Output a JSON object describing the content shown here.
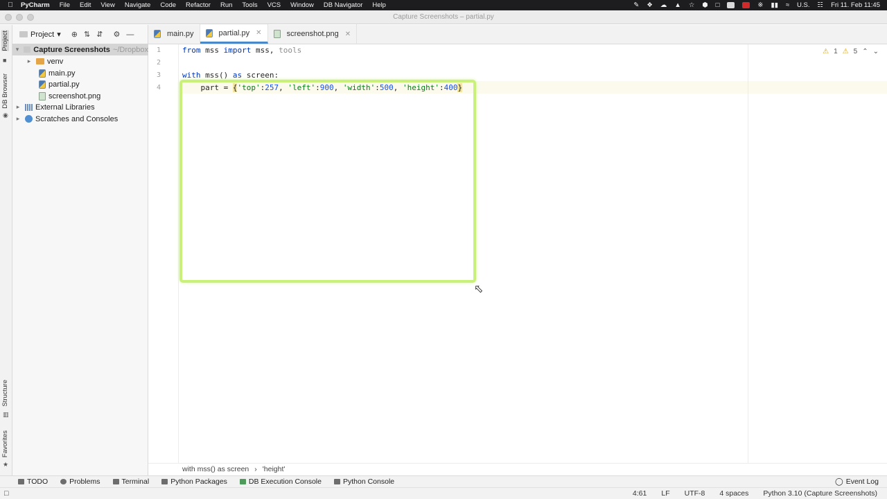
{
  "menubar": {
    "app_name": "PyCharm",
    "items": [
      "File",
      "Edit",
      "View",
      "Navigate",
      "Code",
      "Refactor",
      "Run",
      "Tools",
      "VCS",
      "Window",
      "DB Navigator",
      "Help"
    ],
    "input_source": "U.S.",
    "clock": "Fri 11. Feb  11:45"
  },
  "window": {
    "title": "Capture Screenshots – partial.py"
  },
  "left_stripe": {
    "project": "Project",
    "db_browser": "DB Browser",
    "structure": "Structure",
    "favorites": "Favorites"
  },
  "project_panel": {
    "selector_label": "Project",
    "tree": [
      {
        "label": "Capture Screenshots",
        "hint": "~/Dropbox",
        "kind": "root"
      },
      {
        "label": "venv",
        "kind": "folder"
      },
      {
        "label": "main.py",
        "kind": "py"
      },
      {
        "label": "partial.py",
        "kind": "py"
      },
      {
        "label": "screenshot.png",
        "kind": "png"
      },
      {
        "label": "External Libraries",
        "kind": "lib"
      },
      {
        "label": "Scratches and Consoles",
        "kind": "scratch"
      }
    ]
  },
  "tabs": [
    {
      "label": "main.py",
      "active": false
    },
    {
      "label": "partial.py",
      "active": true
    },
    {
      "label": "screenshot.png",
      "active": false
    }
  ],
  "editor": {
    "line_numbers": [
      "1",
      "2",
      "3",
      "4"
    ],
    "code": {
      "l1_from": "from",
      "l1_mss": " mss ",
      "l1_import": "import",
      "l1_rest": " mss, ",
      "l1_tools": "tools",
      "l3_with": "with",
      "l3_rest": " mss() ",
      "l3_as": "as",
      "l3_end": " screen:",
      "l4_indent": "    part = ",
      "l4_open": "{",
      "l4_k1": "'top'",
      "l4_c1": ":",
      "l4_v1": "257",
      "l4_s1": ", ",
      "l4_k2": "'left'",
      "l4_c2": ":",
      "l4_v2": "900",
      "l4_s2": ", ",
      "l4_k3": "'width'",
      "l4_c3": ":",
      "l4_v3": "500",
      "l4_s3": ", ",
      "l4_k4": "'height'",
      "l4_c4": ":",
      "l4_v4": "400",
      "l4_close": "}"
    },
    "inspections": {
      "errors": "1",
      "warnings": "5"
    }
  },
  "breadcrumb": [
    "with mss() as screen",
    "'height'"
  ],
  "breadcrumb_sep": "›",
  "tool_windows": [
    "TODO",
    "Problems",
    "Terminal",
    "Python Packages",
    "DB Execution Console",
    "Python Console"
  ],
  "event_log": "Event Log",
  "status": {
    "position": "4:61",
    "line_sep": "LF",
    "encoding": "UTF-8",
    "indent": "4 spaces",
    "interpreter": "Python 3.10 (Capture Screenshots)"
  },
  "colors": {
    "capture_box": "#c8f07a",
    "keyword": "#0033b3",
    "string": "#067d17",
    "number": "#1750eb",
    "tab_underline": "#4a88c7"
  }
}
